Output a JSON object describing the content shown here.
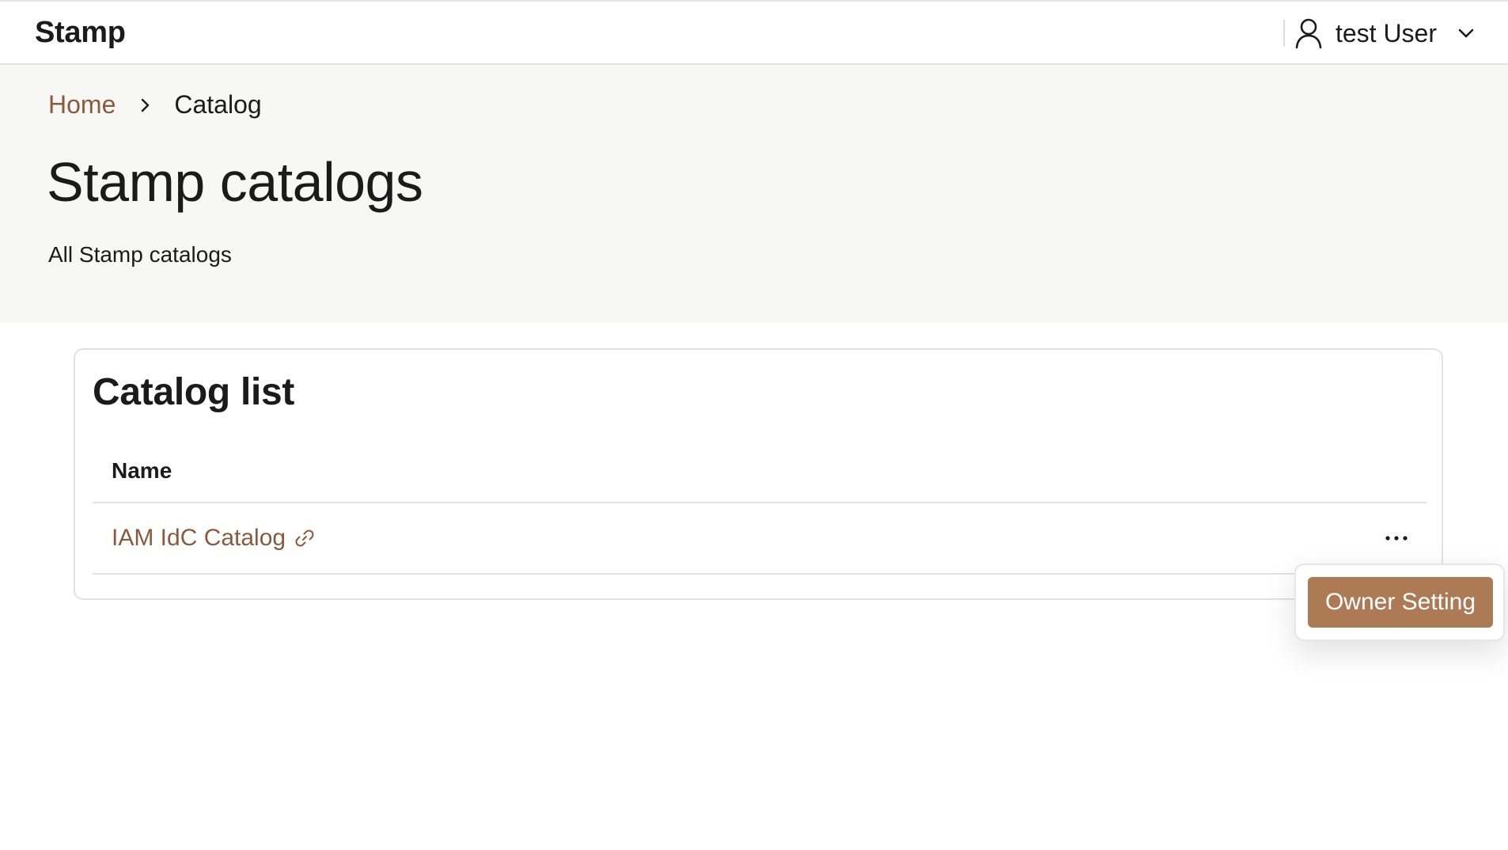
{
  "app": {
    "brand": "Stamp"
  },
  "user": {
    "name": "test User",
    "icon": "user-icon",
    "menu_icon": "chevron-down-icon"
  },
  "breadcrumb": {
    "home": "Home",
    "separator_icon": "chevron-right-icon",
    "current": "Catalog"
  },
  "page": {
    "title": "Stamp catalogs",
    "subtitle": "All Stamp catalogs"
  },
  "card": {
    "title": "Catalog list",
    "columns": [
      "Name"
    ],
    "rows": [
      {
        "name": "IAM IdC Catalog",
        "icon": "link-icon",
        "actions_icon": "more-horizontal-icon"
      }
    ]
  },
  "menu": {
    "owner_setting": "Owner Setting"
  },
  "colors": {
    "accent": "#ad7a56",
    "link": "#8a5a3c",
    "header_bg": "#f7f8f6",
    "border": "#e2e2e2"
  }
}
